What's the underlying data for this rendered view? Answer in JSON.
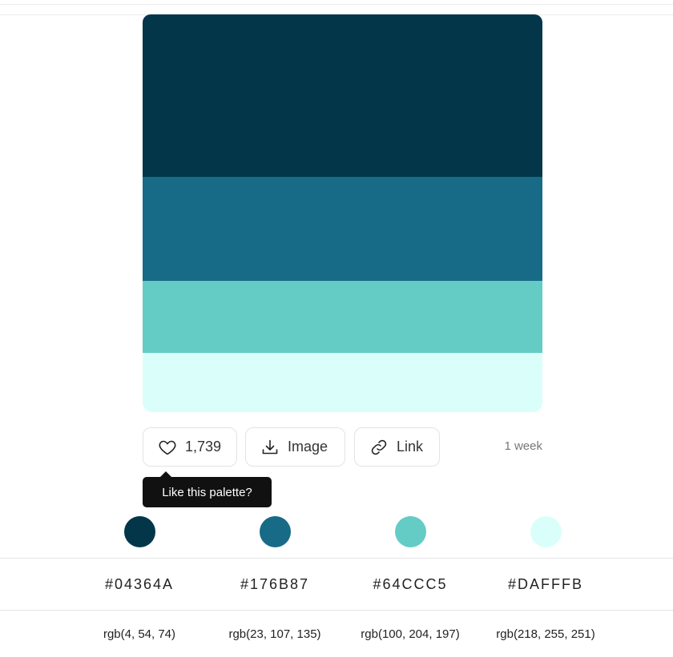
{
  "palette": {
    "colors": [
      {
        "hex": "#04364A",
        "rgb": "rgb(4, 54, 74)",
        "value": "#04364A"
      },
      {
        "hex": "#176B87",
        "rgb": "rgb(23, 107, 135)",
        "value": "#176B87"
      },
      {
        "hex": "#64CCC5",
        "rgb": "rgb(100, 204, 197)",
        "value": "#64CCC5"
      },
      {
        "hex": "#DAFFFB",
        "rgb": "rgb(218, 255, 251)",
        "value": "#DAFFFB"
      }
    ]
  },
  "actions": {
    "like_count": "1,739",
    "image_label": "Image",
    "link_label": "Link",
    "age": "1 week"
  },
  "tooltip": {
    "text": "Like this palette?"
  },
  "icons": {
    "like": "heart-icon",
    "image": "download-icon",
    "link": "link-icon"
  }
}
